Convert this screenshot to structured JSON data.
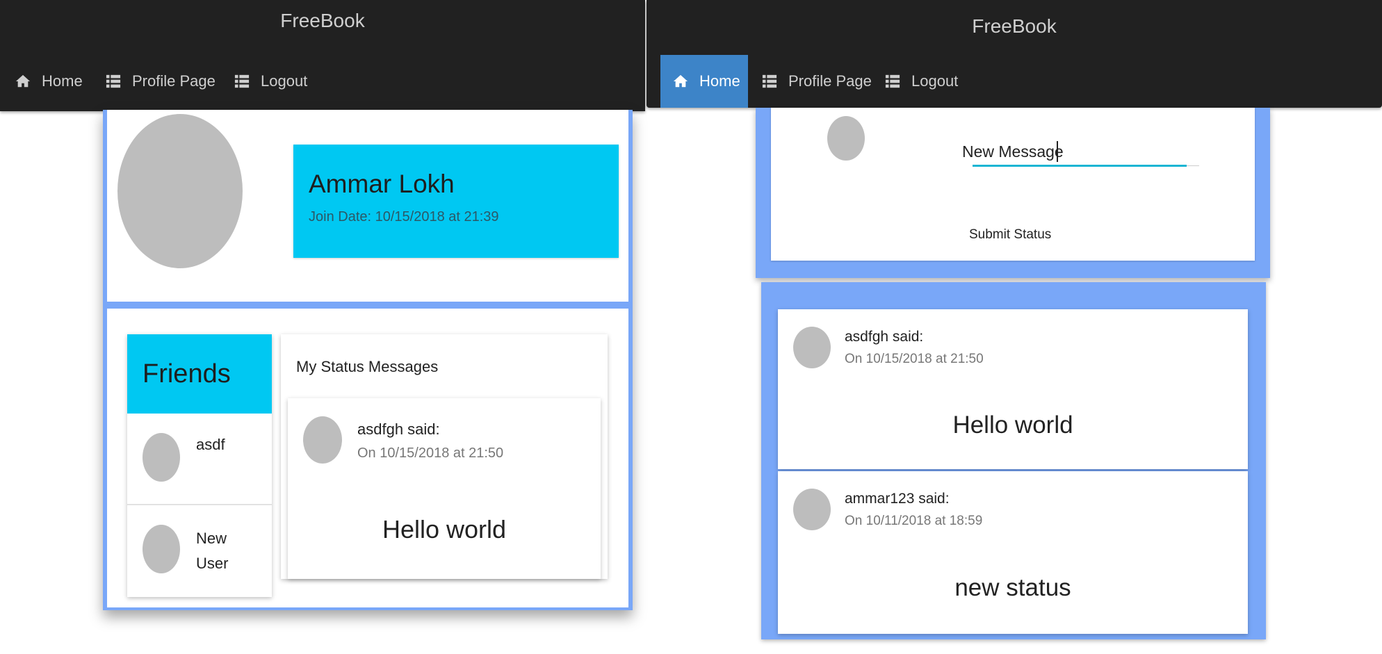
{
  "left": {
    "brand": "FreeBook",
    "nav": [
      {
        "label": "Home",
        "icon": "home-icon"
      },
      {
        "label": "Profile Page",
        "icon": "list-icon"
      },
      {
        "label": "Logout",
        "icon": "list-icon"
      }
    ],
    "profile": {
      "name": "Ammar Lokh",
      "join_date": "Join Date: 10/15/2018 at 21:39"
    },
    "friends": {
      "title": "Friends",
      "items": [
        {
          "name": "asdf"
        },
        {
          "name": "New\nUser"
        }
      ]
    },
    "status_panel": {
      "title": "My Status Messages",
      "post": {
        "author": "asdfgh said:",
        "date": "On 10/15/2018 at 21:50",
        "message": "Hello world"
      }
    }
  },
  "right": {
    "brand": "FreeBook",
    "nav": [
      {
        "label": "Home",
        "icon": "home-icon",
        "active": true
      },
      {
        "label": "Profile Page",
        "icon": "list-icon"
      },
      {
        "label": "Logout",
        "icon": "list-icon"
      }
    ],
    "composer": {
      "input_value": "New Message",
      "submit_label": "Submit Status"
    },
    "feed": [
      {
        "author": "asdfgh said:",
        "date": "On 10/15/2018 at 21:50",
        "message": "Hello world"
      },
      {
        "author": "ammar123 said:",
        "date": "On 10/11/2018 at 18:59",
        "message": "new status"
      }
    ]
  },
  "colors": {
    "navbar": "#212121",
    "accent_cyan": "#00c8f2",
    "panel_blue": "#79a7f8",
    "active_nav": "#3d84c8"
  }
}
